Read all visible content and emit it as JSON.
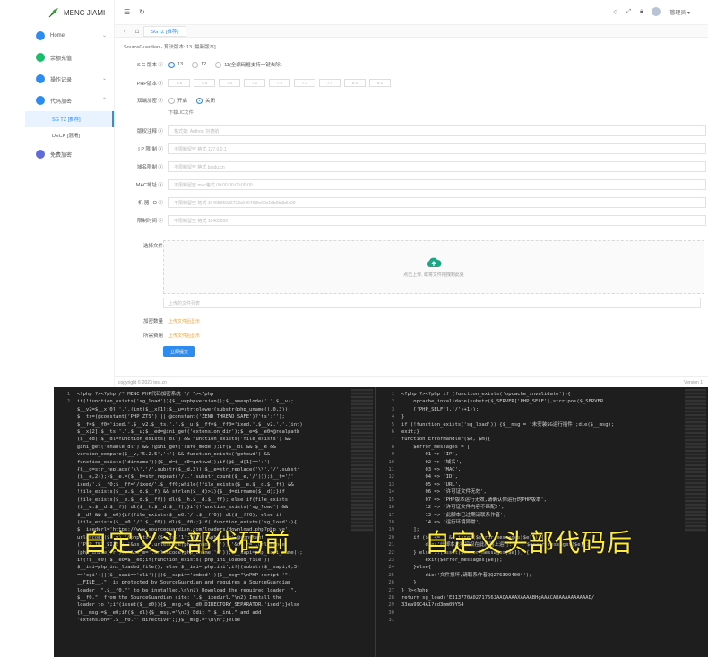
{
  "brand": {
    "name": "MENC JIAMI"
  },
  "sidebar": {
    "items": [
      {
        "label": "Home",
        "color": "#2d8cf0",
        "arrow": "⌄"
      },
      {
        "label": "余额充值",
        "color": "#19be6b",
        "arrow": ""
      },
      {
        "label": "操作记录",
        "color": "#2d8cf0",
        "arrow": "⌄"
      },
      {
        "label": "代码加密",
        "color": "#2d8cf0",
        "arrow": "⌃"
      }
    ],
    "sub_items": [
      {
        "label": "SG TZ [推荐]",
        "active": true
      },
      {
        "label": "DECK [混淆]",
        "active": false
      }
    ],
    "last_item": {
      "label": "免费加密",
      "color": "#5f6bd9"
    }
  },
  "topbar": {
    "user": "管理员 ▾"
  },
  "tabs": {
    "active": "SGTZ [推荐]"
  },
  "content": {
    "crumb": "SourceGuardian - 算法版本: 13 [最新版本]",
    "sg_label": "S G 版本 ⓘ",
    "sg_options": [
      "13",
      "12",
      "11(全编码框支持一键去除)"
    ],
    "php_label": "PHP版本 ⓘ",
    "php_versions": [
      "5.5",
      "5.6",
      "7.0",
      "7.1",
      "7.2",
      "7.3",
      "7.4",
      "8.0",
      "8.1"
    ],
    "dual_label": "双端加密 ⓘ",
    "dual_options": [
      "开启",
      "关闭"
    ],
    "dual_hint": "下载LIC文件",
    "fields": [
      {
        "label": "版权注释 ⓘ",
        "placeholder": "格式如: Author: 刘德航"
      },
      {
        "label": "I P 限 制 ⓘ",
        "placeholder": "不限制留空 格式 127.0.0.1"
      },
      {
        "label": "域名限制 ⓘ",
        "placeholder": "不限制留空 格式 baidu.cn"
      },
      {
        "label": "MAC地址 ⓘ",
        "placeholder": "不限制留空 mac格式 00:00:00:00:00:00"
      },
      {
        "label": "机 器 I D ⓘ",
        "placeholder": "不限制留空 格式 10495959d2723c949493fe90c10b0b9b6c99"
      },
      {
        "label": "限制时间 ⓘ",
        "placeholder": "不限制留空 格式 10403000"
      }
    ],
    "file_label": "选择文件",
    "upload_text": "点击上传, 或将文件拖拽到此处",
    "file_placeholder": "上传的文件列表",
    "encrypt_label": "加密数量",
    "encrypt_value": "上传文件后显示",
    "cost_label": "所需费用",
    "cost_value": "上传文件后显示",
    "submit_label": "立即提交"
  },
  "footer": {
    "copyright": "copyright © 2023 test.cn",
    "version": "Version 1"
  },
  "code": {
    "left_lines": [
      "<?php ?><?php /* MENC PHP代码加密系统 */ ?><?php",
      "if(!function_exists('sg_load')){$__v=phpversion();$__x=explode('.',$__v);",
      "$__v2=$__x[0].'.'.(int)$__x[1];$__u=strtolower(substr(php_uname(),0,3));",
      "$__ts=(@constant('PHP_ZTS') || @constant('ZEND_THREAD_SAFE')?'ts':'');",
      "$__f=$__f0='ixed.'.$__v2.$__ts.'.'.$__u;$__ff=$__ff0='ixed.'.$__v2.'.'.(int)",
      "$__x[2].$__ts.'.'.$__u;$__ed=@ini_get('extension_dir');$__e=$__e0=@realpath",
      "($__ed);$__dl=function_exists('dl') && function_exists('file_exists') &&",
      "@ini_get('enable_dl') && !@ini_get('safe_mode');if($__dl && $__e &&",
      "version_compare($__v,'5.2.5','<') && function_exists('getcwd') &&",
      "function_exists('dirname')){$__d=$__d0=getcwd();if(@$__d[1]==':')",
      "{$__d=str_replace('\\\\','/',substr($__d,2));$__e=str_replace('\\\\','/',substr",
      "($__e,2));}$__e.=($__h=str_repeat('/..',substr_count($__e,'/')));$__f='/'",
      "ixed/'.$__f0;$__ff='/ixed/'.$__ff0;while(!file_exists($__e.$__d.$__ff) &&",
      "!file_exists($__e.$__d.$__f) && strlen($__d)>1){$__d=dirname($__d);}if",
      "(file_exists($__e.$__d.$__ff)) dl($__h.$__d.$__ff); else if(file_exists",
      "($__e.$__d.$__f)) dl($__h.$__d.$__f);}if(!function_exists('sg_load') &&",
      "$__dl && $__e0){if(file_exists($__e0.'/'.$__ff0)) dl($__ff0); else if",
      "(file_exists($__e0.'/'.$__f0)) dl($__f0);}if(!function_exists('sg_load')){",
      "$__ixedurl='https://www.sourceguardian.com/loaders/download.php?php_v='.",
      "urlencode($__v).'&php_ts='.($__ts?'1':'0').'&php_is='.@constant",
      "('PHP_INT_SIZE').'&os_s='.urlencode(php_uname('s')).'&os_r='.urlencode",
      "(php_uname('r')).'&os_m='.urlencode(php_uname('m'));$__sapi=php_sapi_name();",
      "if(!$__e0) $__e0=$__ed;if(function_exists('php_ini_loaded_file'))",
      "$__ini=php_ini_loaded_file(); else $__ini='php.ini';if((substr($__sapi,0,3)",
      "=='cgi')||($__sapi=='cli')||($__sapi=='embed')){$__msg=\"\\nPHP script '\".",
      "__FILE__.\"' is protected by SourceGuardian and requires a SourceGuardian",
      "loader '\".$__f0.\"' to be installed.\\n\\n1) Download the required loader '\".",
      "$__f0.\"' from the SourceGuardian site: \".$__ixedurl.\"\\n2) Install the",
      "loader to \";if(isset($__d0)){$__msg.=$__d0.DIRECTORY_SEPARATOR.'ixed';}else",
      "{$__msg.=$__e0;if($__dl){$__msg.=\"\\n3) Edit \".$__ini.\" and add",
      "'extension=\".$__f0.\"' directive\";}}$__msg.=\"\\n\\n\";}else"
    ],
    "right_lines": [
      "<?php ?><?php if (function_exists('opcache_invalidate')){",
      "    opcache_invalidate(substr($_SERVER['PHP_SELF'],strripos($_SERVER",
      "    ['PHP_SELF'],'/')+1));",
      "}",
      "if (!function_exists('sg_load')) {$__msg = '未安装SG运行插件';die($__msg);",
      "exit;}",
      "",
      "function ErrorHandler($e, $m){",
      "    $error_messages = [",
      "        01 => 'IP',",
      "        02 => '域名',",
      "        03 => 'MAC',",
      "        04 => 'ID',",
      "        05 => 'URL',",
      "        06 => '许可证文件无效',",
      "        07 => 'PHP版本运行无效,请确认你运行的PHP版本',",
      "        12 => '许可证文件内容不匹配!',",
      "        13 => '此脚本已过期请联系作者',",
      "        14 => '运行环境异常',",
      "    ];",
      "",
      "    if ($e <= 5 && isset($error_messages[$e])) {",
      "        die('此脚本未被授权在此机器上运行: ' . $error_messages[$e]);",
      "    } else if(isset($error_messages[$e])) {",
      "        exit($error_messages[$e]);",
      "    }else{",
      "        die('文件损坏,请联系作者QQ2763994004');",
      "    }",
      "} ?><?php",
      "return sg_load('E313770A0271756JAAQAAAAXAAAABHgAAACABAAAAAAAAAAD/",
      "33ea99C4A1?cd3mm09Y54"
    ],
    "left_overlay": "自定义头部代码前",
    "right_overlay": "自定义头部代码后"
  }
}
